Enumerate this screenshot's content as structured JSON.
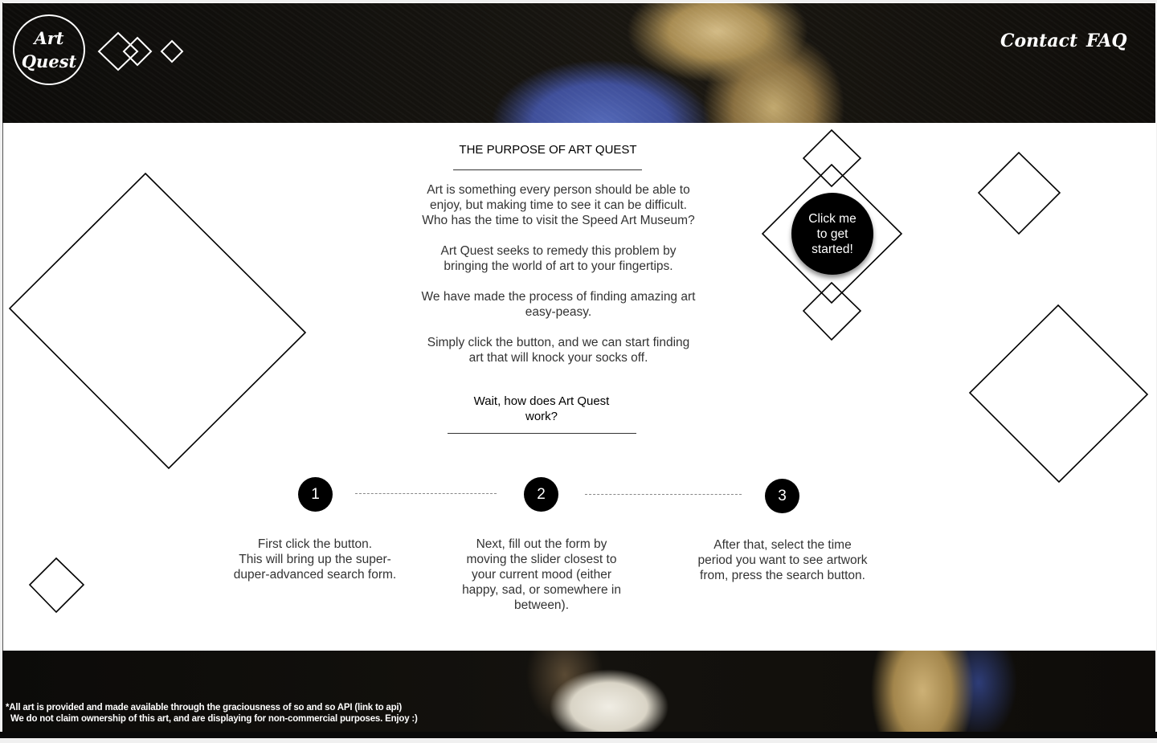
{
  "header": {
    "logo_line1": "Art",
    "logo_line2": "Quest",
    "nav": {
      "contact": "Contact",
      "faq": "FAQ"
    }
  },
  "purpose": {
    "title": "THE PURPOSE OF ART QUEST",
    "paragraphs": [
      [
        "Art is something every person should be able to",
        "enjoy, but making time to see it can be difficult.",
        "Who has the time to visit the Speed Art Museum?"
      ],
      [
        "Art Quest seeks to remedy this problem by",
        "bringing the world of art to your fingertips."
      ],
      [
        "We have made the process of finding amazing art",
        "easy-peasy."
      ],
      [
        "Simply click the button, and we can start finding",
        "art that will knock your socks off."
      ]
    ]
  },
  "how": {
    "title_line1": "Wait, how does Art Quest",
    "title_line2": "work?"
  },
  "cta": {
    "line1": "Click me",
    "line2": "to get",
    "line3": "started!"
  },
  "steps": [
    {
      "number": "1",
      "lines": [
        "First click the button.",
        "This will bring up the super-",
        "duper-advanced search form."
      ]
    },
    {
      "number": "2",
      "lines": [
        "Next, fill out the form by",
        "moving the slider closest to",
        "your current mood (either",
        "happy, sad, or somewhere in",
        "between)."
      ]
    },
    {
      "number": "3",
      "lines": [
        "After that, select the time",
        "period you want to see artwork",
        "from, press the search button."
      ]
    }
  ],
  "footer": {
    "line1": "*All art is provided and made available through the graciousness of so and so API (link to api)",
    "line2": "  We do not claim ownership of this art, and are displaying for non-commercial purposes. Enjoy :)"
  }
}
